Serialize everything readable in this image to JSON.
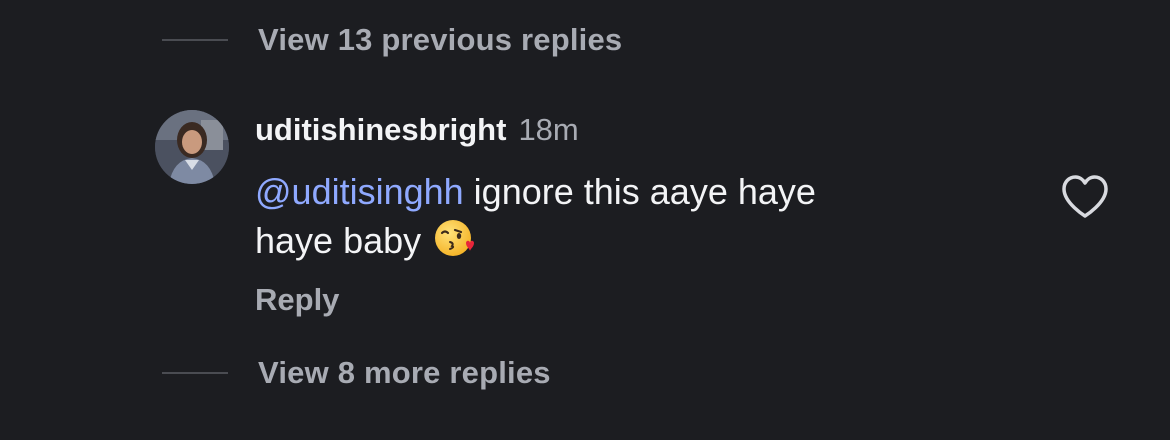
{
  "thread": {
    "view_previous_label": "View 13 previous replies",
    "view_more_label": "View 8 more replies"
  },
  "comment": {
    "username": "uditishinesbright",
    "time": "18m",
    "mention": "@uditisinghh",
    "text_line_1": " ignore this aaye haye",
    "text_line_2": "haye baby",
    "emoji": "face-blowing-a-kiss-emoji",
    "reply_label": "Reply",
    "like_icon": "heart-outline-icon"
  },
  "colors": {
    "background": "#1c1d21",
    "primary_text": "#f3f4f6",
    "secondary_text": "#a8abb3",
    "mention": "#8fa9ff"
  }
}
